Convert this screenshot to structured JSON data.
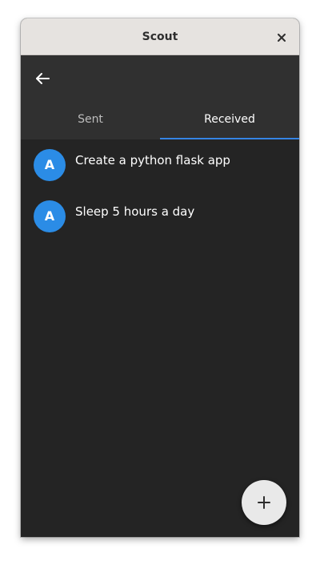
{
  "window": {
    "title": "Scout",
    "close_icon": "close-icon"
  },
  "header": {
    "back_icon": "arrow-left-icon"
  },
  "tabs": [
    {
      "label": "Sent",
      "active": false
    },
    {
      "label": "Received",
      "active": true
    }
  ],
  "messages": [
    {
      "avatar": "A",
      "text": "Create a python flask app"
    },
    {
      "avatar": "A",
      "text": "Sleep 5 hours a day"
    }
  ],
  "fab": {
    "icon": "plus-icon"
  },
  "colors": {
    "accent": "#3584e4",
    "avatar": "#2b8ce6",
    "background": "#242424",
    "headerbar": "#303030",
    "titlebar": "#e6e3e0"
  }
}
